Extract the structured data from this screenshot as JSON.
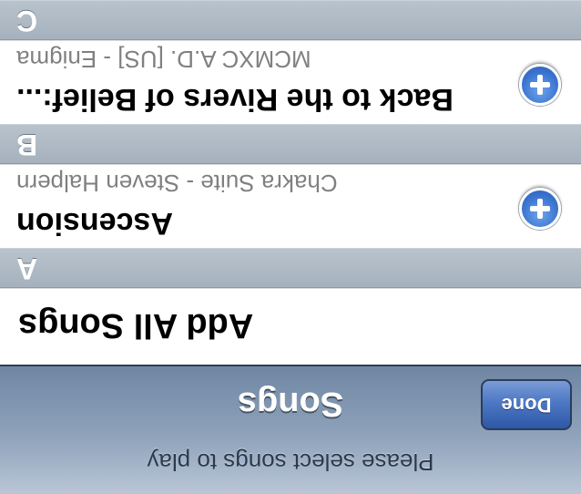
{
  "navbar": {
    "prompt": "Please select songs to play",
    "title": "Songs",
    "done_label": "Done"
  },
  "list": {
    "add_all_label": "Add All Songs",
    "sections": [
      {
        "letter": "A",
        "songs": []
      },
      {
        "letter": "B",
        "songs": [
          {
            "title": "Ascension",
            "subtitle": "Chakra Suite - Steven Halpern",
            "action_icon": "add-icon"
          }
        ]
      },
      {
        "letter": "C",
        "songs": [
          {
            "title": "Back to the Rivers of Belief:...",
            "subtitle": "MCMXC A.D. [US] - Enigma",
            "action_icon": "add-icon"
          }
        ]
      }
    ]
  },
  "colors": {
    "navbar": "#8fa3bb",
    "done_button": "#4d78c4",
    "add_button": "#3a74d1",
    "section_header": "#b0bbc7"
  }
}
